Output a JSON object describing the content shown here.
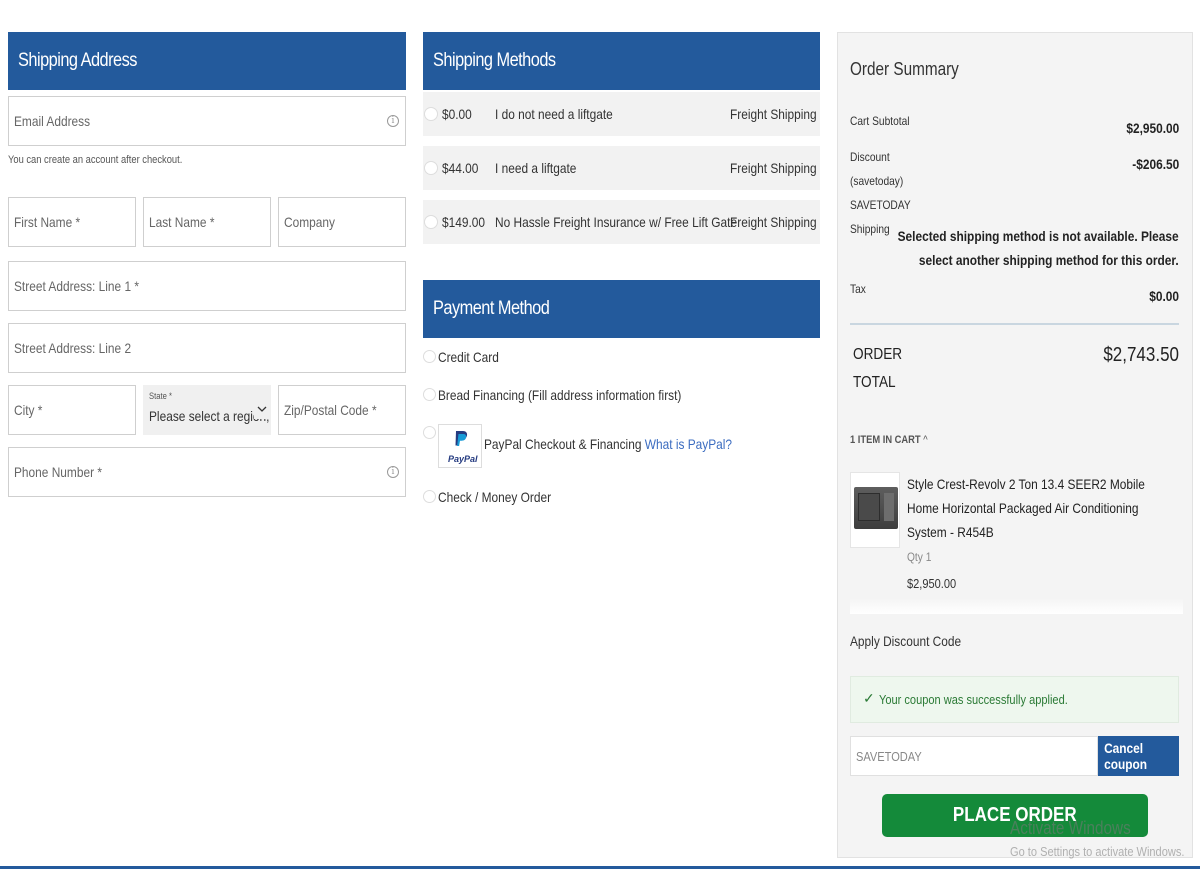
{
  "shipping_address": {
    "header": "Shipping Address",
    "email_placeholder": "Email Address",
    "email_note": "You can create an account after checkout.",
    "first_name_placeholder": "First Name *",
    "last_name_placeholder": "Last Name *",
    "company_placeholder": "Company",
    "street1_placeholder": "Street Address: Line 1 *",
    "street2_placeholder": "Street Address: Line 2",
    "city_placeholder": "City *",
    "state_label": "State",
    "state_required": "*",
    "state_value": "Please select a region, s",
    "zip_placeholder": "Zip/Postal Code *",
    "phone_placeholder": "Phone Number *"
  },
  "shipping_methods": {
    "header": "Shipping Methods",
    "options": [
      {
        "price": "$0.00",
        "description": "I do not need a liftgate",
        "carrier": "Freight Shipping"
      },
      {
        "price": "$44.00",
        "description": "I need a liftgate",
        "carrier": "Freight Shipping"
      },
      {
        "price": "$149.00",
        "description": "No Hassle Freight Insurance w/ Free Lift Gate",
        "carrier": "Freight Shipping"
      }
    ]
  },
  "payment_method": {
    "header": "Payment Method",
    "options": [
      {
        "label": "Credit Card"
      },
      {
        "label": "Bread Financing (Fill address information first)"
      },
      {
        "label": "PayPal Checkout & Financing",
        "link": "What is PayPal?",
        "logo_text": "PayPal"
      },
      {
        "label": "Check / Money Order"
      }
    ]
  },
  "order_summary": {
    "title": "Order Summary",
    "cart_subtotal_label": "Cart Subtotal",
    "cart_subtotal_value": "$2,950.00",
    "discount_label_1": "Discount",
    "discount_label_2": "(savetoday)",
    "discount_label_3": "SAVETODAY",
    "discount_value": "-$206.50",
    "shipping_label": "Shipping",
    "shipping_message_1": "Selected shipping method is not available. Please",
    "shipping_message_2": "select another shipping method for this order.",
    "tax_label": "Tax",
    "tax_value": "$0.00",
    "order_total_label_1": "ORDER",
    "order_total_label_2": "TOTAL",
    "order_total_value": "$2,743.50",
    "items_in_cart": "1 ITEM IN CART",
    "item": {
      "name_1": "Style Crest-Revolv 2 Ton 13.4 SEER2 Mobile",
      "name_2": "Home Horizontal Packaged Air Conditioning",
      "name_3": "System - R454B",
      "qty": "Qty 1",
      "price": "$2,950.00"
    },
    "discount_code_title": "Apply Discount Code",
    "coupon_success": "Your coupon was successfully applied.",
    "coupon_value": "SAVETODAY",
    "cancel_coupon_label": "Cancel coupon",
    "place_order_label": "PLACE ORDER"
  },
  "windows_watermark": {
    "line1": "Activate Windows",
    "line2": "Go to Settings to activate Windows."
  },
  "colors": {
    "header_blue": "#235a9c",
    "place_order_green": "#148a3a",
    "link_blue": "#3b6cc0",
    "success_bg": "#eef7ee"
  }
}
